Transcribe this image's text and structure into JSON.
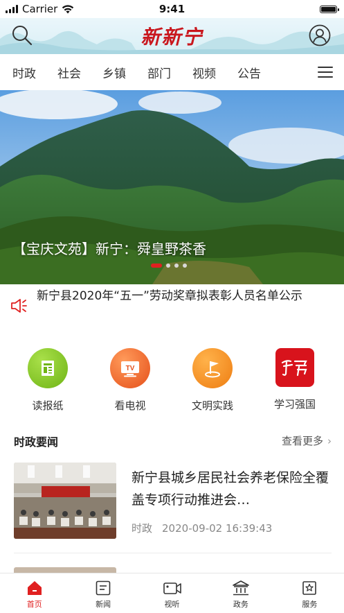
{
  "status_bar": {
    "carrier": "Carrier",
    "time": "9:41",
    "battery_level": 1.0
  },
  "header": {
    "logo": "新新宁",
    "search_icon": "search-icon",
    "profile_icon": "user-profile-icon"
  },
  "tabs": [
    {
      "label": "时政"
    },
    {
      "label": "社会"
    },
    {
      "label": "乡镇"
    },
    {
      "label": "部门"
    },
    {
      "label": "视频"
    },
    {
      "label": "公告"
    }
  ],
  "banner": {
    "caption": "【宝庆文苑】新宁：舜皇野茶香",
    "slide_count": 4,
    "active_slide": 1
  },
  "notice": {
    "text": "新宁县2020年“五一”劳动奖章拟表彰人员名单公示",
    "icon": "speaker-icon"
  },
  "quick_links": [
    {
      "label": "读报纸",
      "icon": "newspaper-icon",
      "color": "#7cc11d"
    },
    {
      "label": "看电视",
      "icon": "tv-icon",
      "color": "#f2681e"
    },
    {
      "label": "文明实践",
      "icon": "flag-icon",
      "color": "#f2881c"
    },
    {
      "label": "学习强国",
      "icon": "xuexi-logo-icon",
      "color": "#d8131c"
    }
  ],
  "section": {
    "title": "时政要闻",
    "more": "查看更多"
  },
  "news": [
    {
      "title": "新宁县城乡居民社会养老保险全覆盖专项行动推进会…",
      "category": "时政",
      "datetime": "2020-09-02 16:39:43"
    }
  ],
  "tabbar": [
    {
      "label": "首页",
      "icon": "home-icon",
      "active": true
    },
    {
      "label": "新闻",
      "icon": "news-icon",
      "active": false
    },
    {
      "label": "视听",
      "icon": "video-icon",
      "active": false
    },
    {
      "label": "政务",
      "icon": "government-icon",
      "active": false
    },
    {
      "label": "服务",
      "icon": "service-icon",
      "active": false
    }
  ],
  "colors": {
    "accent": "#e02020",
    "brand_red": "#c9171e"
  }
}
